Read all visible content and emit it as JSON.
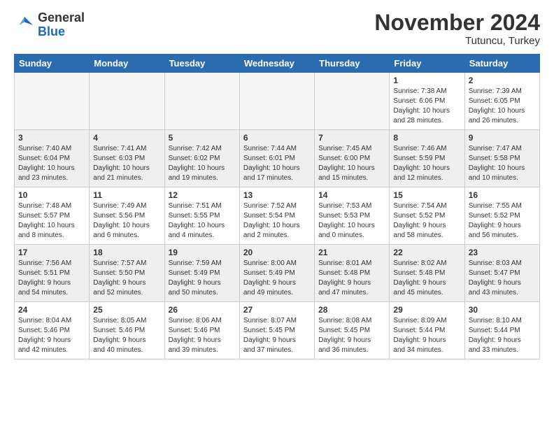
{
  "header": {
    "logo_general": "General",
    "logo_blue": "Blue",
    "month_title": "November 2024",
    "location": "Tutuncu, Turkey"
  },
  "calendar": {
    "days_of_week": [
      "Sunday",
      "Monday",
      "Tuesday",
      "Wednesday",
      "Thursday",
      "Friday",
      "Saturday"
    ],
    "weeks": [
      [
        {
          "day": "",
          "info": "",
          "empty": true
        },
        {
          "day": "",
          "info": "",
          "empty": true
        },
        {
          "day": "",
          "info": "",
          "empty": true
        },
        {
          "day": "",
          "info": "",
          "empty": true
        },
        {
          "day": "",
          "info": "",
          "empty": true
        },
        {
          "day": "1",
          "info": "Sunrise: 7:38 AM\nSunset: 6:06 PM\nDaylight: 10 hours\nand 28 minutes.",
          "empty": false
        },
        {
          "day": "2",
          "info": "Sunrise: 7:39 AM\nSunset: 6:05 PM\nDaylight: 10 hours\nand 26 minutes.",
          "empty": false
        }
      ],
      [
        {
          "day": "3",
          "info": "Sunrise: 7:40 AM\nSunset: 6:04 PM\nDaylight: 10 hours\nand 23 minutes.",
          "empty": false
        },
        {
          "day": "4",
          "info": "Sunrise: 7:41 AM\nSunset: 6:03 PM\nDaylight: 10 hours\nand 21 minutes.",
          "empty": false
        },
        {
          "day": "5",
          "info": "Sunrise: 7:42 AM\nSunset: 6:02 PM\nDaylight: 10 hours\nand 19 minutes.",
          "empty": false
        },
        {
          "day": "6",
          "info": "Sunrise: 7:44 AM\nSunset: 6:01 PM\nDaylight: 10 hours\nand 17 minutes.",
          "empty": false
        },
        {
          "day": "7",
          "info": "Sunrise: 7:45 AM\nSunset: 6:00 PM\nDaylight: 10 hours\nand 15 minutes.",
          "empty": false
        },
        {
          "day": "8",
          "info": "Sunrise: 7:46 AM\nSunset: 5:59 PM\nDaylight: 10 hours\nand 12 minutes.",
          "empty": false
        },
        {
          "day": "9",
          "info": "Sunrise: 7:47 AM\nSunset: 5:58 PM\nDaylight: 10 hours\nand 10 minutes.",
          "empty": false
        }
      ],
      [
        {
          "day": "10",
          "info": "Sunrise: 7:48 AM\nSunset: 5:57 PM\nDaylight: 10 hours\nand 8 minutes.",
          "empty": false
        },
        {
          "day": "11",
          "info": "Sunrise: 7:49 AM\nSunset: 5:56 PM\nDaylight: 10 hours\nand 6 minutes.",
          "empty": false
        },
        {
          "day": "12",
          "info": "Sunrise: 7:51 AM\nSunset: 5:55 PM\nDaylight: 10 hours\nand 4 minutes.",
          "empty": false
        },
        {
          "day": "13",
          "info": "Sunrise: 7:52 AM\nSunset: 5:54 PM\nDaylight: 10 hours\nand 2 minutes.",
          "empty": false
        },
        {
          "day": "14",
          "info": "Sunrise: 7:53 AM\nSunset: 5:53 PM\nDaylight: 10 hours\nand 0 minutes.",
          "empty": false
        },
        {
          "day": "15",
          "info": "Sunrise: 7:54 AM\nSunset: 5:52 PM\nDaylight: 9 hours\nand 58 minutes.",
          "empty": false
        },
        {
          "day": "16",
          "info": "Sunrise: 7:55 AM\nSunset: 5:52 PM\nDaylight: 9 hours\nand 56 minutes.",
          "empty": false
        }
      ],
      [
        {
          "day": "17",
          "info": "Sunrise: 7:56 AM\nSunset: 5:51 PM\nDaylight: 9 hours\nand 54 minutes.",
          "empty": false
        },
        {
          "day": "18",
          "info": "Sunrise: 7:57 AM\nSunset: 5:50 PM\nDaylight: 9 hours\nand 52 minutes.",
          "empty": false
        },
        {
          "day": "19",
          "info": "Sunrise: 7:59 AM\nSunset: 5:49 PM\nDaylight: 9 hours\nand 50 minutes.",
          "empty": false
        },
        {
          "day": "20",
          "info": "Sunrise: 8:00 AM\nSunset: 5:49 PM\nDaylight: 9 hours\nand 49 minutes.",
          "empty": false
        },
        {
          "day": "21",
          "info": "Sunrise: 8:01 AM\nSunset: 5:48 PM\nDaylight: 9 hours\nand 47 minutes.",
          "empty": false
        },
        {
          "day": "22",
          "info": "Sunrise: 8:02 AM\nSunset: 5:48 PM\nDaylight: 9 hours\nand 45 minutes.",
          "empty": false
        },
        {
          "day": "23",
          "info": "Sunrise: 8:03 AM\nSunset: 5:47 PM\nDaylight: 9 hours\nand 43 minutes.",
          "empty": false
        }
      ],
      [
        {
          "day": "24",
          "info": "Sunrise: 8:04 AM\nSunset: 5:46 PM\nDaylight: 9 hours\nand 42 minutes.",
          "empty": false
        },
        {
          "day": "25",
          "info": "Sunrise: 8:05 AM\nSunset: 5:46 PM\nDaylight: 9 hours\nand 40 minutes.",
          "empty": false
        },
        {
          "day": "26",
          "info": "Sunrise: 8:06 AM\nSunset: 5:46 PM\nDaylight: 9 hours\nand 39 minutes.",
          "empty": false
        },
        {
          "day": "27",
          "info": "Sunrise: 8:07 AM\nSunset: 5:45 PM\nDaylight: 9 hours\nand 37 minutes.",
          "empty": false
        },
        {
          "day": "28",
          "info": "Sunrise: 8:08 AM\nSunset: 5:45 PM\nDaylight: 9 hours\nand 36 minutes.",
          "empty": false
        },
        {
          "day": "29",
          "info": "Sunrise: 8:09 AM\nSunset: 5:44 PM\nDaylight: 9 hours\nand 34 minutes.",
          "empty": false
        },
        {
          "day": "30",
          "info": "Sunrise: 8:10 AM\nSunset: 5:44 PM\nDaylight: 9 hours\nand 33 minutes.",
          "empty": false
        }
      ]
    ]
  }
}
